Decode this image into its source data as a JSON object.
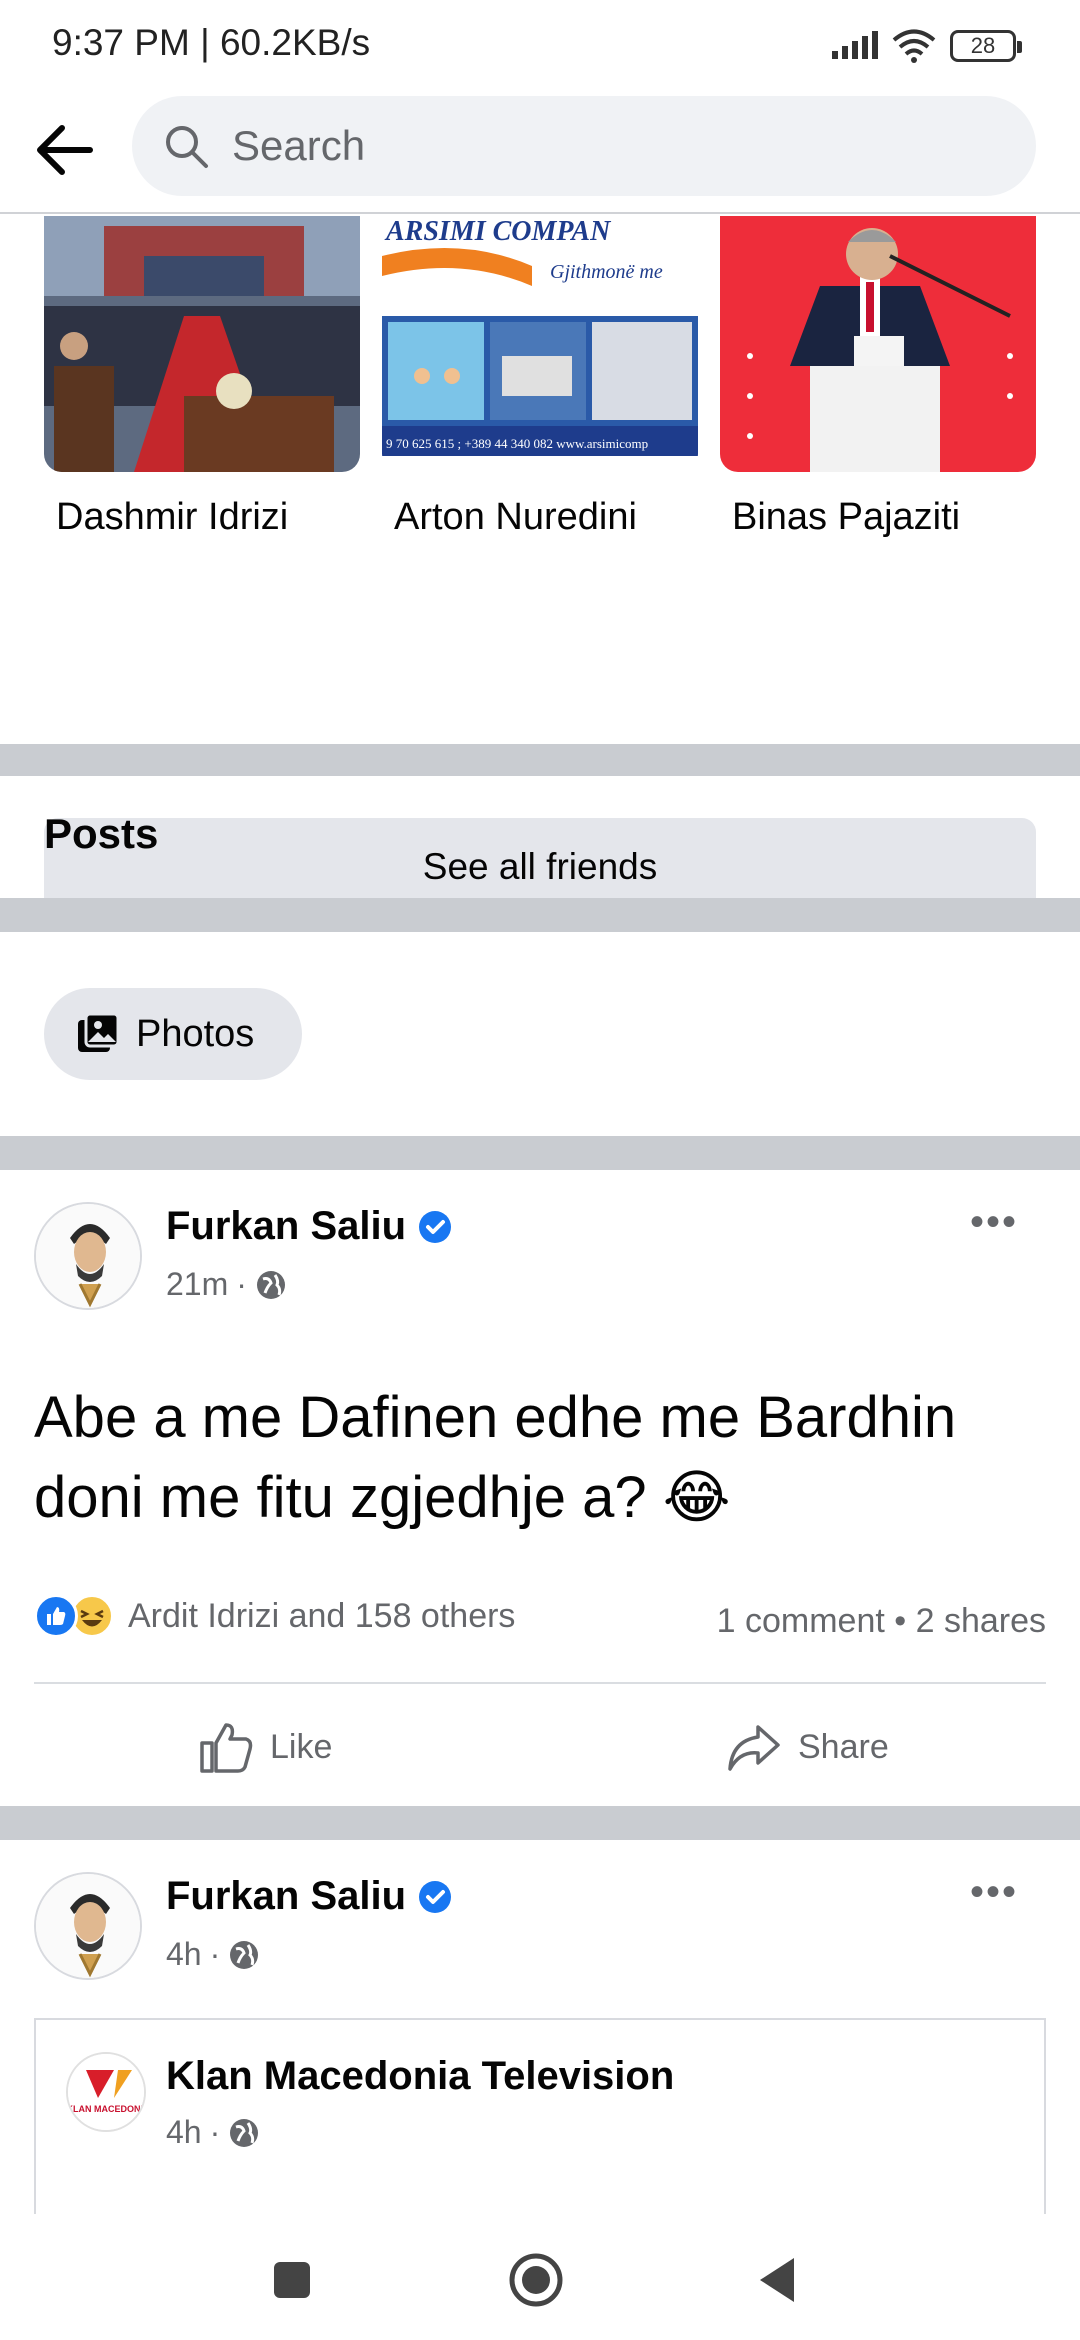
{
  "status": {
    "time": "9:37 PM | 60.2KB/s",
    "battery": "28"
  },
  "search": {
    "placeholder": "Search"
  },
  "friends": [
    {
      "name": "Dashmir Idrizi"
    },
    {
      "name": "Arton Nuredini"
    },
    {
      "name": "Binas Pajaziti"
    }
  ],
  "ad_image": {
    "line1": "ARSIMI   COMPAN",
    "line2": "Gjithmonë me",
    "line3": "9 70 625 615 ; +389 44 340 082   www.arsimicomp"
  },
  "see_all_label": "See all friends",
  "posts_title": "Posts",
  "photos_label": "Photos",
  "post1": {
    "author": "Furkan Saliu",
    "time": "21m",
    "text": "Abe a me Dafinen edhe me Bardhin doni me fitu zgjedhje a? 😂",
    "reactions_text": "Ardit Idrizi and 158 others",
    "counts": "1 comment • 2 shares",
    "like_label": "Like",
    "share_label": "Share"
  },
  "post2": {
    "author": "Furkan Saliu",
    "time": "4h",
    "shared_page": "Klan Macedonia Television",
    "shared_time": "4h",
    "shared_logo_text": "KLAN MACEDONIA"
  },
  "colors": {
    "brand_blue": "#1877f2",
    "divider": "#c9ccd1",
    "chip_bg": "#e4e6eb"
  }
}
